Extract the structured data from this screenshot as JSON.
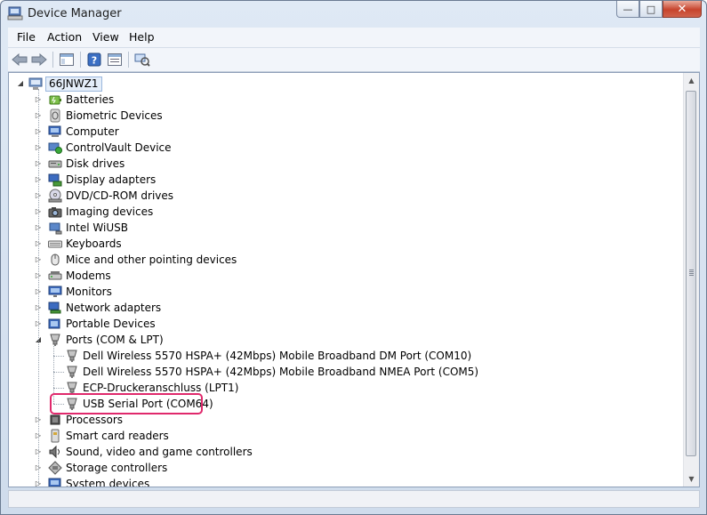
{
  "window": {
    "title": "Device Manager",
    "caption": {
      "minimize": "—",
      "maximize": "□",
      "close": "✕"
    }
  },
  "menu": [
    "File",
    "Action",
    "View",
    "Help"
  ],
  "toolbar": [
    {
      "icon": "back-arrow-icon"
    },
    {
      "icon": "forward-arrow-icon"
    },
    {
      "icon": "console-tree-icon"
    },
    {
      "icon": "help-icon"
    },
    {
      "icon": "properties-icon"
    },
    {
      "icon": "scan-hardware-icon"
    }
  ],
  "tree": {
    "root": "66JNWZ1",
    "categories": [
      {
        "label": "Batteries",
        "icon": "battery-icon"
      },
      {
        "label": "Biometric Devices",
        "icon": "biometric-icon"
      },
      {
        "label": "Computer",
        "icon": "computer-icon"
      },
      {
        "label": "ControlVault Device",
        "icon": "controlvault-icon"
      },
      {
        "label": "Disk drives",
        "icon": "disk-drive-icon"
      },
      {
        "label": "Display adapters",
        "icon": "display-adapter-icon"
      },
      {
        "label": "DVD/CD-ROM drives",
        "icon": "dvd-drive-icon"
      },
      {
        "label": "Imaging devices",
        "icon": "imaging-device-icon"
      },
      {
        "label": "Intel WiUSB",
        "icon": "wiusb-icon"
      },
      {
        "label": "Keyboards",
        "icon": "keyboard-icon"
      },
      {
        "label": "Mice and other pointing devices",
        "icon": "mouse-icon"
      },
      {
        "label": "Modems",
        "icon": "modem-icon"
      },
      {
        "label": "Monitors",
        "icon": "monitor-icon"
      },
      {
        "label": "Network adapters",
        "icon": "network-adapter-icon"
      },
      {
        "label": "Portable Devices",
        "icon": "portable-device-icon"
      },
      {
        "label": "Ports (COM & LPT)",
        "icon": "port-icon",
        "expanded": true,
        "children": [
          "Dell Wireless 5570 HSPA+ (42Mbps) Mobile Broadband DM Port (COM10)",
          "Dell Wireless 5570 HSPA+ (42Mbps) Mobile Broadband NMEA Port (COM5)",
          "ECP-Druckeranschluss (LPT1)",
          "USB Serial Port (COM64)"
        ]
      },
      {
        "label": "Processors",
        "icon": "processor-icon"
      },
      {
        "label": "Smart card readers",
        "icon": "smart-card-icon"
      },
      {
        "label": "Sound, video and game controllers",
        "icon": "sound-icon"
      },
      {
        "label": "Storage controllers",
        "icon": "storage-controller-icon"
      },
      {
        "label": "System devices",
        "icon": "system-device-icon"
      }
    ]
  },
  "highlight": {
    "target": "USB Serial Port (COM64)"
  }
}
